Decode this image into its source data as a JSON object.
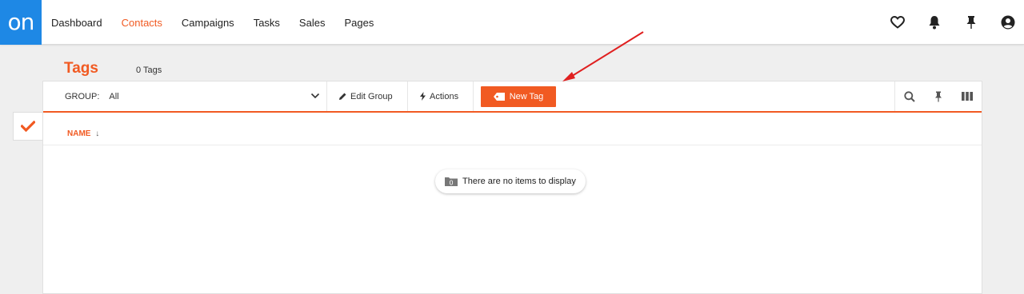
{
  "logo": "on",
  "nav": {
    "items": [
      {
        "label": "Dashboard",
        "active": false
      },
      {
        "label": "Contacts",
        "active": true
      },
      {
        "label": "Campaigns",
        "active": false
      },
      {
        "label": "Tasks",
        "active": false
      },
      {
        "label": "Sales",
        "active": false
      },
      {
        "label": "Pages",
        "active": false
      }
    ]
  },
  "top_icons": [
    "heart-icon",
    "bell-icon",
    "pin-icon",
    "user-icon"
  ],
  "header": {
    "title": "Tags",
    "count": "0 Tags"
  },
  "toolbar": {
    "group_label": "GROUP:",
    "group_value": "All",
    "edit_group": "Edit Group",
    "actions": "Actions",
    "new_tag": "New Tag",
    "right_icons": [
      "search-icon",
      "pin-icon",
      "columns-icon"
    ]
  },
  "table": {
    "columns": [
      "NAME"
    ],
    "sort_indicator": "↓"
  },
  "empty_message": "There are no items to display",
  "colors": {
    "accent": "#f15a22",
    "brand": "#1e88e5",
    "annotation_arrow": "#e02020"
  }
}
